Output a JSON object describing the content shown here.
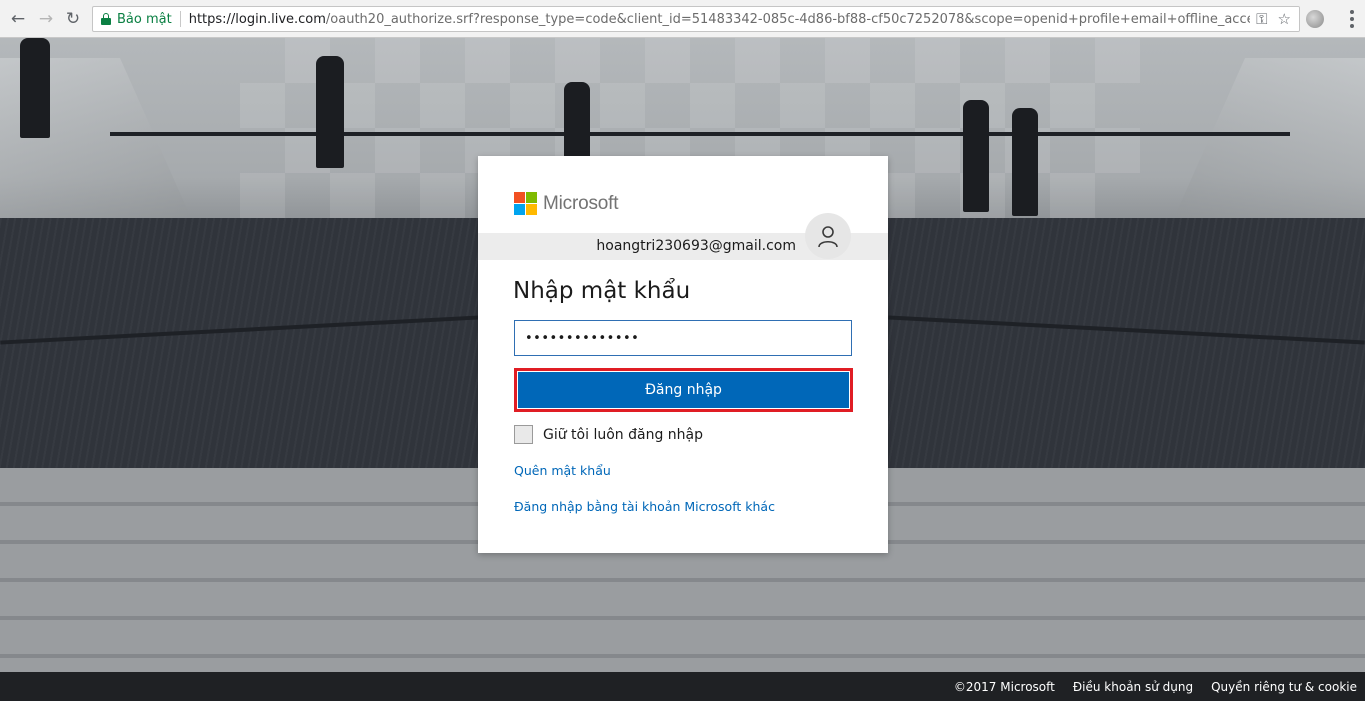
{
  "browser": {
    "secure_label": "Bảo mật",
    "url_host": "https://login.live.com",
    "url_path": "/oauth20_authorize.srf?response_type=code&client_id=51483342-085c-4d86-bf88-cf50c7252078&scope=openid+profile+email+offline_access&re..."
  },
  "card": {
    "brand": "Microsoft",
    "email": "hoangtri230693@gmail.com",
    "title": "Nhập mật khẩu",
    "password_value": "••••••••••••••",
    "signin_label": "Đăng nhập",
    "keep_signed_in_label": "Giữ tôi luôn đăng nhập",
    "forgot_password_link": "Quên mật khẩu",
    "other_account_link": "Đăng nhập bằng tài khoản Microsoft khác"
  },
  "footer": {
    "copyright": "©2017 Microsoft",
    "terms": "Điều khoản sử dụng",
    "privacy": "Quyền riêng tư & cookie"
  },
  "colors": {
    "accent": "#0067b8",
    "highlight": "#e01d24",
    "secure": "#0b8043"
  },
  "icons": [
    "back-arrow-icon",
    "forward-arrow-icon",
    "reload-icon",
    "lock-icon",
    "key-icon",
    "star-icon",
    "extension-icon",
    "menu-icon",
    "microsoft-logo-icon",
    "user-avatar-icon"
  ]
}
